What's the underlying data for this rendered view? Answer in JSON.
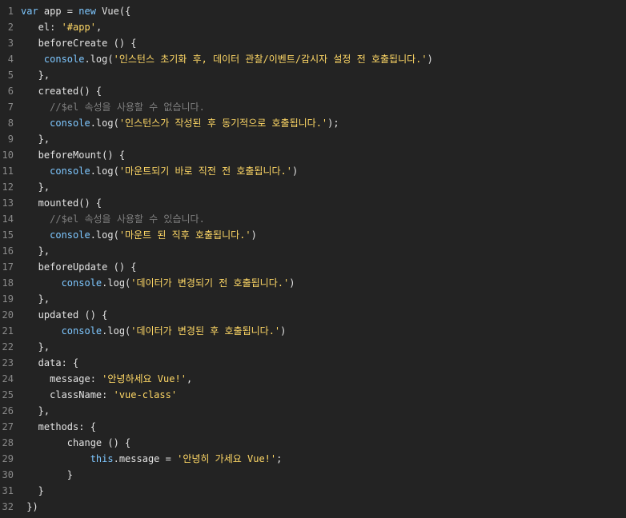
{
  "editor": {
    "lines": [
      {
        "n": "1",
        "segments": [
          {
            "t": "var",
            "c": "kw"
          },
          {
            "t": " app = ",
            "c": "p"
          },
          {
            "t": "new",
            "c": "kw"
          },
          {
            "t": " Vue({",
            "c": "p"
          }
        ]
      },
      {
        "n": "2",
        "segments": [
          {
            "t": "   el: ",
            "c": "p"
          },
          {
            "t": "'#app'",
            "c": "str"
          },
          {
            "t": ",",
            "c": "p"
          }
        ]
      },
      {
        "n": "3",
        "segments": [
          {
            "t": "   beforeCreate () {",
            "c": "p"
          }
        ]
      },
      {
        "n": "4",
        "segments": [
          {
            "t": "    ",
            "c": "p"
          },
          {
            "t": "console",
            "c": "kw"
          },
          {
            "t": ".log(",
            "c": "p"
          },
          {
            "t": "'인스턴스 초기화 후, 데이터 관찰/이벤트/감시자 설정 전 호출됩니다.'",
            "c": "str"
          },
          {
            "t": ")",
            "c": "p"
          }
        ]
      },
      {
        "n": "5",
        "segments": [
          {
            "t": "   },",
            "c": "p"
          }
        ]
      },
      {
        "n": "6",
        "segments": [
          {
            "t": "   created() {",
            "c": "p"
          }
        ]
      },
      {
        "n": "7",
        "segments": [
          {
            "t": "     ",
            "c": "p"
          },
          {
            "t": "//$el 속성을 사용할 수 없습니다.",
            "c": "cmt"
          }
        ]
      },
      {
        "n": "8",
        "segments": [
          {
            "t": "     ",
            "c": "p"
          },
          {
            "t": "console",
            "c": "kw"
          },
          {
            "t": ".log(",
            "c": "p"
          },
          {
            "t": "'인스턴스가 작성된 후 동기적으로 호출됩니다.'",
            "c": "str"
          },
          {
            "t": ");",
            "c": "p"
          }
        ]
      },
      {
        "n": "9",
        "segments": [
          {
            "t": "   },",
            "c": "p"
          }
        ]
      },
      {
        "n": "10",
        "segments": [
          {
            "t": "   beforeMount() {",
            "c": "p"
          }
        ]
      },
      {
        "n": "11",
        "segments": [
          {
            "t": "     ",
            "c": "p"
          },
          {
            "t": "console",
            "c": "kw"
          },
          {
            "t": ".log(",
            "c": "p"
          },
          {
            "t": "'마운트되기 바로 직전 전 호출됩니다.'",
            "c": "str"
          },
          {
            "t": ")",
            "c": "p"
          }
        ]
      },
      {
        "n": "12",
        "segments": [
          {
            "t": "   },",
            "c": "p"
          }
        ]
      },
      {
        "n": "13",
        "segments": [
          {
            "t": "   mounted() {",
            "c": "p"
          }
        ]
      },
      {
        "n": "14",
        "segments": [
          {
            "t": "     ",
            "c": "p"
          },
          {
            "t": "//$el 속성을 사용할 수 있습니다.",
            "c": "cmt"
          }
        ]
      },
      {
        "n": "15",
        "segments": [
          {
            "t": "     ",
            "c": "p"
          },
          {
            "t": "console",
            "c": "kw"
          },
          {
            "t": ".log(",
            "c": "p"
          },
          {
            "t": "'마운트 된 직후 호출됩니다.'",
            "c": "str"
          },
          {
            "t": ")",
            "c": "p"
          }
        ]
      },
      {
        "n": "16",
        "segments": [
          {
            "t": "   },",
            "c": "p"
          }
        ]
      },
      {
        "n": "17",
        "segments": [
          {
            "t": "   beforeUpdate () {",
            "c": "p"
          }
        ]
      },
      {
        "n": "18",
        "segments": [
          {
            "t": "       ",
            "c": "p"
          },
          {
            "t": "console",
            "c": "kw"
          },
          {
            "t": ".log(",
            "c": "p"
          },
          {
            "t": "'데이터가 변경되기 전 호출됩니다.'",
            "c": "str"
          },
          {
            "t": ")",
            "c": "p"
          }
        ]
      },
      {
        "n": "19",
        "segments": [
          {
            "t": "   },",
            "c": "p"
          }
        ]
      },
      {
        "n": "20",
        "segments": [
          {
            "t": "   updated () {",
            "c": "p"
          }
        ]
      },
      {
        "n": "21",
        "segments": [
          {
            "t": "       ",
            "c": "p"
          },
          {
            "t": "console",
            "c": "kw"
          },
          {
            "t": ".log(",
            "c": "p"
          },
          {
            "t": "'데이터가 변경된 후 호출됩니다.'",
            "c": "str"
          },
          {
            "t": ")",
            "c": "p"
          }
        ]
      },
      {
        "n": "22",
        "segments": [
          {
            "t": "   },",
            "c": "p"
          }
        ]
      },
      {
        "n": "23",
        "segments": [
          {
            "t": "   data: {",
            "c": "p"
          }
        ]
      },
      {
        "n": "24",
        "segments": [
          {
            "t": "     message: ",
            "c": "p"
          },
          {
            "t": "'안녕하세요 Vue!'",
            "c": "str"
          },
          {
            "t": ",",
            "c": "p"
          }
        ]
      },
      {
        "n": "25",
        "segments": [
          {
            "t": "     className: ",
            "c": "p"
          },
          {
            "t": "'vue-class'",
            "c": "str"
          }
        ]
      },
      {
        "n": "26",
        "segments": [
          {
            "t": "   },",
            "c": "p"
          }
        ]
      },
      {
        "n": "27",
        "segments": [
          {
            "t": "   methods: {",
            "c": "p"
          }
        ]
      },
      {
        "n": "28",
        "segments": [
          {
            "t": "        change () {",
            "c": "p"
          }
        ]
      },
      {
        "n": "29",
        "segments": [
          {
            "t": "            ",
            "c": "p"
          },
          {
            "t": "this",
            "c": "kw"
          },
          {
            "t": ".message = ",
            "c": "p"
          },
          {
            "t": "'안녕히 가세요 Vue!'",
            "c": "str"
          },
          {
            "t": ";",
            "c": "p"
          }
        ]
      },
      {
        "n": "30",
        "segments": [
          {
            "t": "        }",
            "c": "p"
          }
        ]
      },
      {
        "n": "31",
        "segments": [
          {
            "t": "   }",
            "c": "p"
          }
        ]
      },
      {
        "n": "32",
        "segments": [
          {
            "t": " })",
            "c": "p"
          }
        ]
      }
    ]
  },
  "colors": {
    "background": "#232323",
    "line_number": "#8a8a8a",
    "keyword": "#7ec7ff",
    "string": "#ffd866",
    "comment": "#7f7f7f",
    "plain": "#e4e4e4"
  }
}
